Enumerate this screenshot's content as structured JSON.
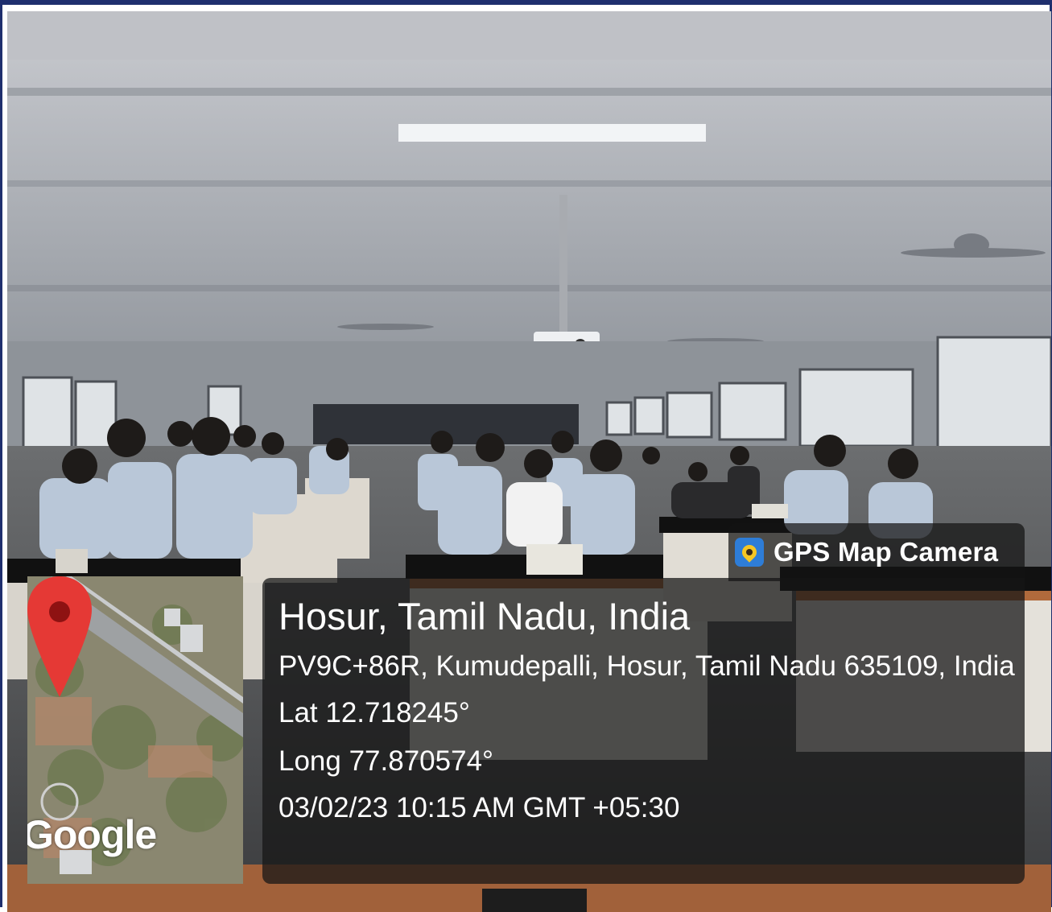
{
  "overlay": {
    "brand_label": "GPS Map Camera",
    "brand_icon": "gps-map-camera-app-icon",
    "location_title": "Hosur, Tamil Nadu, India",
    "address": "PV9C+86R, Kumudepalli, Hosur, Tamil Nadu 635109, India",
    "latitude": "Lat 12.718245°",
    "longitude": "Long 77.870574°",
    "timestamp": "03/02/23 10:15 AM GMT +05:30"
  },
  "map": {
    "provider_logo": "Google",
    "marker_icon": "map-marker-icon"
  },
  "colors": {
    "frame_border": "#1f2f6e",
    "marker": "#e53935",
    "panel": "#161616"
  }
}
